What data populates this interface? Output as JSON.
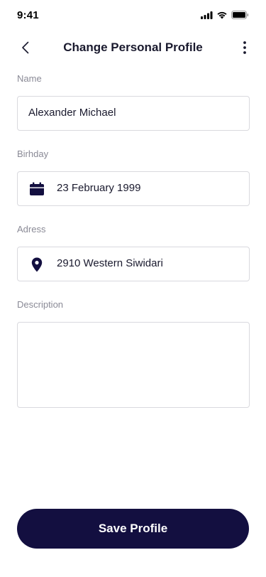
{
  "status_bar": {
    "time": "9:41"
  },
  "header": {
    "title": "Change Personal Profile"
  },
  "form": {
    "name": {
      "label": "Name",
      "value": "Alexander Michael"
    },
    "birthday": {
      "label": "Birhday",
      "value": "23 February 1999",
      "icon": "calendar-icon"
    },
    "address": {
      "label": "Adress",
      "value": "2910 Western Siwidari",
      "icon": "location-pin-icon"
    },
    "description": {
      "label": "Description",
      "value": ""
    }
  },
  "actions": {
    "save_label": "Save Profile"
  },
  "colors": {
    "primary": "#130f40",
    "border": "#d9d9de",
    "label": "#8a8a96"
  }
}
